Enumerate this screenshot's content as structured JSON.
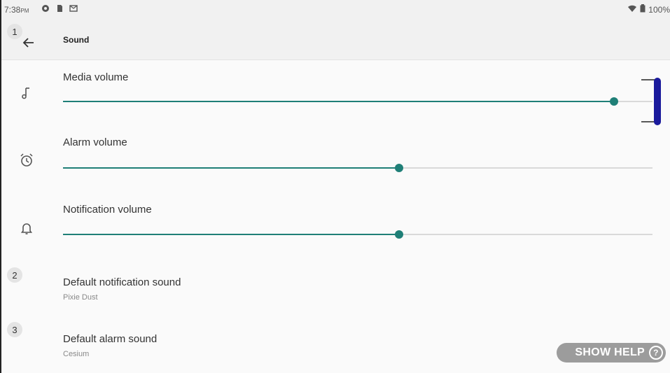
{
  "status_bar": {
    "time": "7:38",
    "ampm": "PM",
    "battery": "100%"
  },
  "app_bar": {
    "title": "Sound"
  },
  "badges": [
    "1",
    "2",
    "3"
  ],
  "volumes": [
    {
      "label": "Media volume",
      "level": 0.935,
      "icon": "music-note-icon"
    },
    {
      "label": "Alarm volume",
      "level": 0.57,
      "icon": "alarm-clock-icon"
    },
    {
      "label": "Notification volume",
      "level": 0.57,
      "icon": "bell-icon"
    }
  ],
  "defaults": [
    {
      "label": "Default notification sound",
      "value": "Pixie Dust"
    },
    {
      "label": "Default alarm sound",
      "value": "Cesium"
    }
  ],
  "help_button": {
    "label": "SHOW HELP",
    "glyph": "?"
  },
  "colors": {
    "accent": "#1f7f77",
    "track": "#d9d9d9",
    "scroll_handle": "#1a1a9c"
  }
}
